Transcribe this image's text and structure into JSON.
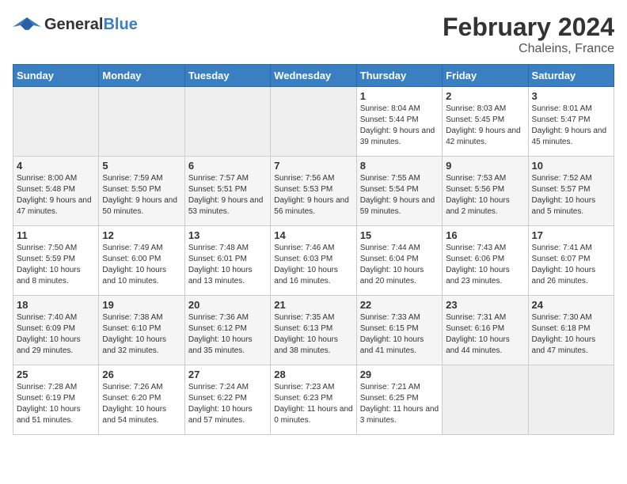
{
  "header": {
    "logo_general": "General",
    "logo_blue": "Blue",
    "month_title": "February 2024",
    "location": "Chaleins, France"
  },
  "weekdays": [
    "Sunday",
    "Monday",
    "Tuesday",
    "Wednesday",
    "Thursday",
    "Friday",
    "Saturday"
  ],
  "weeks": [
    [
      {
        "day": "",
        "empty": true
      },
      {
        "day": "",
        "empty": true
      },
      {
        "day": "",
        "empty": true
      },
      {
        "day": "",
        "empty": true
      },
      {
        "day": "1",
        "rise": "8:04 AM",
        "set": "5:44 PM",
        "daylight": "9 hours and 39 minutes."
      },
      {
        "day": "2",
        "rise": "8:03 AM",
        "set": "5:45 PM",
        "daylight": "9 hours and 42 minutes."
      },
      {
        "day": "3",
        "rise": "8:01 AM",
        "set": "5:47 PM",
        "daylight": "9 hours and 45 minutes."
      }
    ],
    [
      {
        "day": "4",
        "rise": "8:00 AM",
        "set": "5:48 PM",
        "daylight": "9 hours and 47 minutes."
      },
      {
        "day": "5",
        "rise": "7:59 AM",
        "set": "5:50 PM",
        "daylight": "9 hours and 50 minutes."
      },
      {
        "day": "6",
        "rise": "7:57 AM",
        "set": "5:51 PM",
        "daylight": "9 hours and 53 minutes."
      },
      {
        "day": "7",
        "rise": "7:56 AM",
        "set": "5:53 PM",
        "daylight": "9 hours and 56 minutes."
      },
      {
        "day": "8",
        "rise": "7:55 AM",
        "set": "5:54 PM",
        "daylight": "9 hours and 59 minutes."
      },
      {
        "day": "9",
        "rise": "7:53 AM",
        "set": "5:56 PM",
        "daylight": "10 hours and 2 minutes."
      },
      {
        "day": "10",
        "rise": "7:52 AM",
        "set": "5:57 PM",
        "daylight": "10 hours and 5 minutes."
      }
    ],
    [
      {
        "day": "11",
        "rise": "7:50 AM",
        "set": "5:59 PM",
        "daylight": "10 hours and 8 minutes."
      },
      {
        "day": "12",
        "rise": "7:49 AM",
        "set": "6:00 PM",
        "daylight": "10 hours and 10 minutes."
      },
      {
        "day": "13",
        "rise": "7:48 AM",
        "set": "6:01 PM",
        "daylight": "10 hours and 13 minutes."
      },
      {
        "day": "14",
        "rise": "7:46 AM",
        "set": "6:03 PM",
        "daylight": "10 hours and 16 minutes."
      },
      {
        "day": "15",
        "rise": "7:44 AM",
        "set": "6:04 PM",
        "daylight": "10 hours and 20 minutes."
      },
      {
        "day": "16",
        "rise": "7:43 AM",
        "set": "6:06 PM",
        "daylight": "10 hours and 23 minutes."
      },
      {
        "day": "17",
        "rise": "7:41 AM",
        "set": "6:07 PM",
        "daylight": "10 hours and 26 minutes."
      }
    ],
    [
      {
        "day": "18",
        "rise": "7:40 AM",
        "set": "6:09 PM",
        "daylight": "10 hours and 29 minutes."
      },
      {
        "day": "19",
        "rise": "7:38 AM",
        "set": "6:10 PM",
        "daylight": "10 hours and 32 minutes."
      },
      {
        "day": "20",
        "rise": "7:36 AM",
        "set": "6:12 PM",
        "daylight": "10 hours and 35 minutes."
      },
      {
        "day": "21",
        "rise": "7:35 AM",
        "set": "6:13 PM",
        "daylight": "10 hours and 38 minutes."
      },
      {
        "day": "22",
        "rise": "7:33 AM",
        "set": "6:15 PM",
        "daylight": "10 hours and 41 minutes."
      },
      {
        "day": "23",
        "rise": "7:31 AM",
        "set": "6:16 PM",
        "daylight": "10 hours and 44 minutes."
      },
      {
        "day": "24",
        "rise": "7:30 AM",
        "set": "6:18 PM",
        "daylight": "10 hours and 47 minutes."
      }
    ],
    [
      {
        "day": "25",
        "rise": "7:28 AM",
        "set": "6:19 PM",
        "daylight": "10 hours and 51 minutes."
      },
      {
        "day": "26",
        "rise": "7:26 AM",
        "set": "6:20 PM",
        "daylight": "10 hours and 54 minutes."
      },
      {
        "day": "27",
        "rise": "7:24 AM",
        "set": "6:22 PM",
        "daylight": "10 hours and 57 minutes."
      },
      {
        "day": "28",
        "rise": "7:23 AM",
        "set": "6:23 PM",
        "daylight": "11 hours and 0 minutes."
      },
      {
        "day": "29",
        "rise": "7:21 AM",
        "set": "6:25 PM",
        "daylight": "11 hours and 3 minutes."
      },
      {
        "day": "",
        "empty": true
      },
      {
        "day": "",
        "empty": true
      }
    ]
  ]
}
